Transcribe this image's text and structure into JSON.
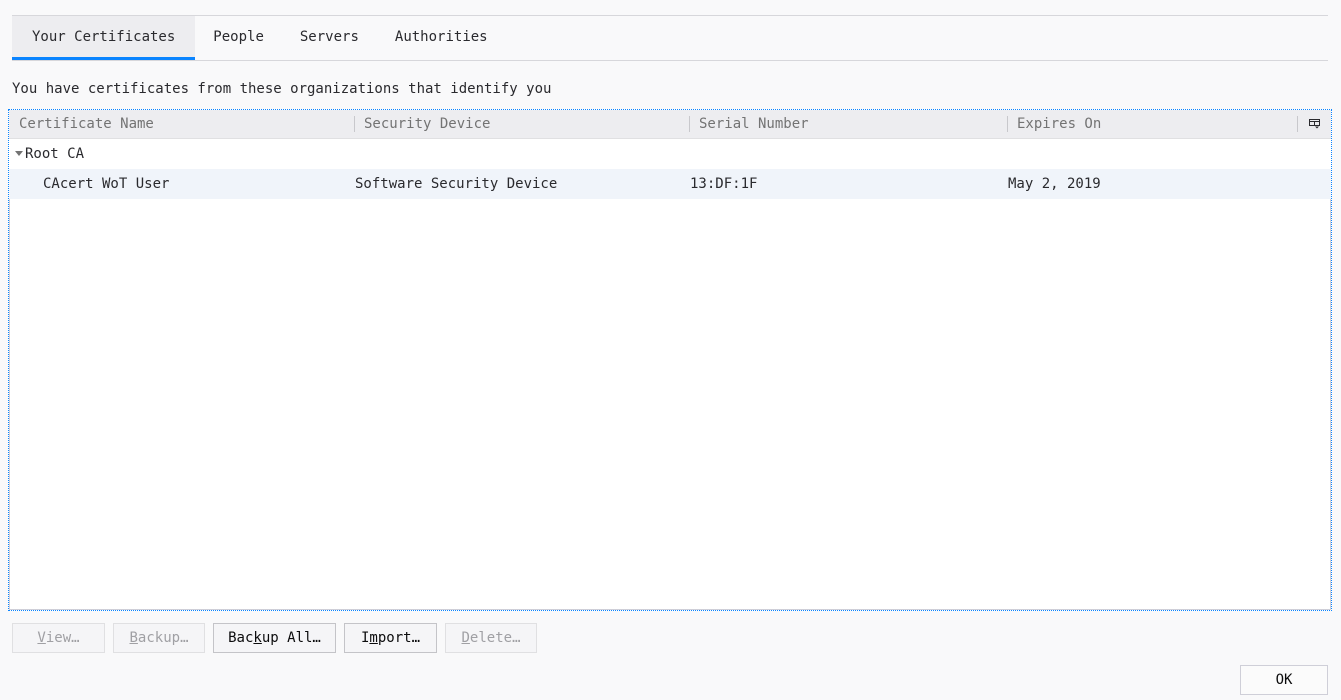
{
  "tabs": [
    {
      "label": "Your Certificates",
      "selected": true
    },
    {
      "label": "People",
      "selected": false
    },
    {
      "label": "Servers",
      "selected": false
    },
    {
      "label": "Authorities",
      "selected": false
    }
  ],
  "intro_text": "You have certificates from these organizations that identify you",
  "columns": [
    "Certificate Name",
    "Security Device",
    "Serial Number",
    "Expires On"
  ],
  "tree": {
    "group_label": "Root CA",
    "rows": [
      {
        "name": "CAcert WoT User",
        "device": "Software Security Device",
        "serial": "13:DF:1F",
        "expires": "May 2, 2019"
      }
    ]
  },
  "buttons": {
    "view": {
      "pre": "",
      "key": "V",
      "post": "iew…",
      "enabled": false
    },
    "backup": {
      "pre": "",
      "key": "B",
      "post": "ackup…",
      "enabled": false
    },
    "backup_all": {
      "pre": "Bac",
      "key": "k",
      "post": "up All…",
      "enabled": true
    },
    "import": {
      "pre": "I",
      "key": "m",
      "post": "port…",
      "enabled": true
    },
    "delete": {
      "pre": "",
      "key": "D",
      "post": "elete…",
      "enabled": false
    }
  },
  "ok_label": "OK",
  "icons": {
    "column_picker": "column-picker-icon",
    "twisty": "twisty-open-icon"
  },
  "colors": {
    "accent": "#0a84ff"
  }
}
